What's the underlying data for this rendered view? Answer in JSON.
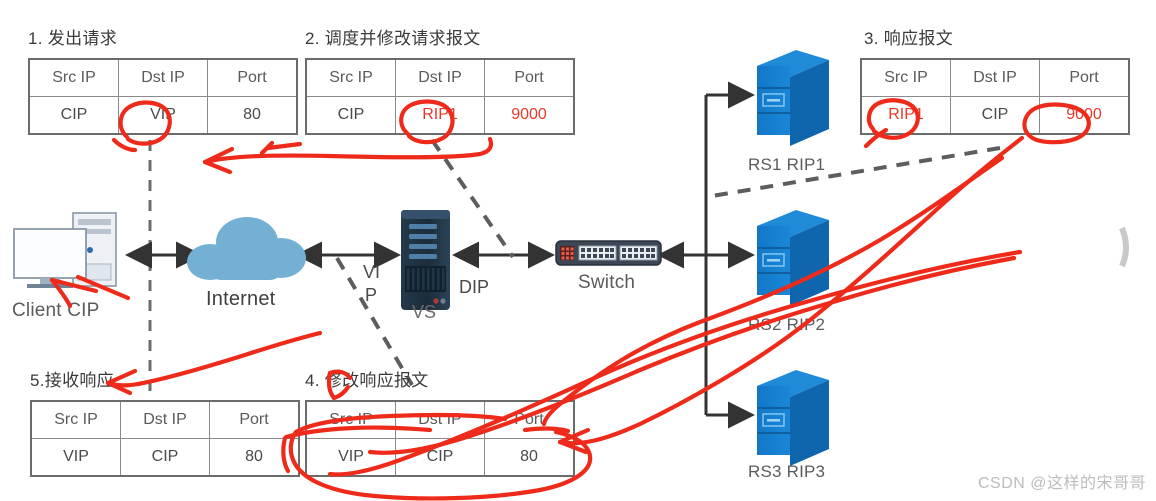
{
  "diagram": {
    "watermark": "CSDN @这样的宋哥哥",
    "accent_red": "#ee2b1a",
    "server_blue": "#1579c8",
    "cloud_blue": "#74b0d4"
  },
  "packets": [
    {
      "id": "p1",
      "title": "1. 发出请求",
      "headers": [
        "Src IP",
        "Dst IP",
        "Port"
      ],
      "values": [
        "CIP",
        "VIP",
        "80"
      ],
      "value_colors": [
        "black",
        "black",
        "black"
      ]
    },
    {
      "id": "p2",
      "title": "2. 调度并修改请求报文",
      "headers": [
        "Src IP",
        "Dst IP",
        "Port"
      ],
      "values": [
        "CIP",
        "RIP1",
        "9000"
      ],
      "value_colors": [
        "black",
        "red",
        "red"
      ]
    },
    {
      "id": "p3",
      "title": "3. 响应报文",
      "headers": [
        "Src IP",
        "Dst IP",
        "Port"
      ],
      "values": [
        "RIP1",
        "CIP",
        "9000"
      ],
      "value_colors": [
        "red",
        "black",
        "red"
      ]
    },
    {
      "id": "p4",
      "title": "4. 修改响应报文",
      "headers": [
        "Src IP",
        "Dst IP",
        "Port"
      ],
      "values": [
        "VIP",
        "CIP",
        "80"
      ],
      "value_colors": [
        "black",
        "black",
        "black"
      ]
    },
    {
      "id": "p5",
      "title": "5.接收响应",
      "headers": [
        "Src IP",
        "Dst IP",
        "Port"
      ],
      "values": [
        "VIP",
        "CIP",
        "80"
      ],
      "value_colors": [
        "black",
        "black",
        "black"
      ]
    }
  ],
  "nodes": {
    "client": "Client CIP",
    "internet": "Internet",
    "vs": "VS",
    "vip_line1": "VI",
    "vip_line2": "P",
    "dip": "DIP",
    "switch": "Switch",
    "rs1": "RS1 RIP1",
    "rs2": "RS2 RIP2",
    "rs3": "RS3 RIP3"
  }
}
